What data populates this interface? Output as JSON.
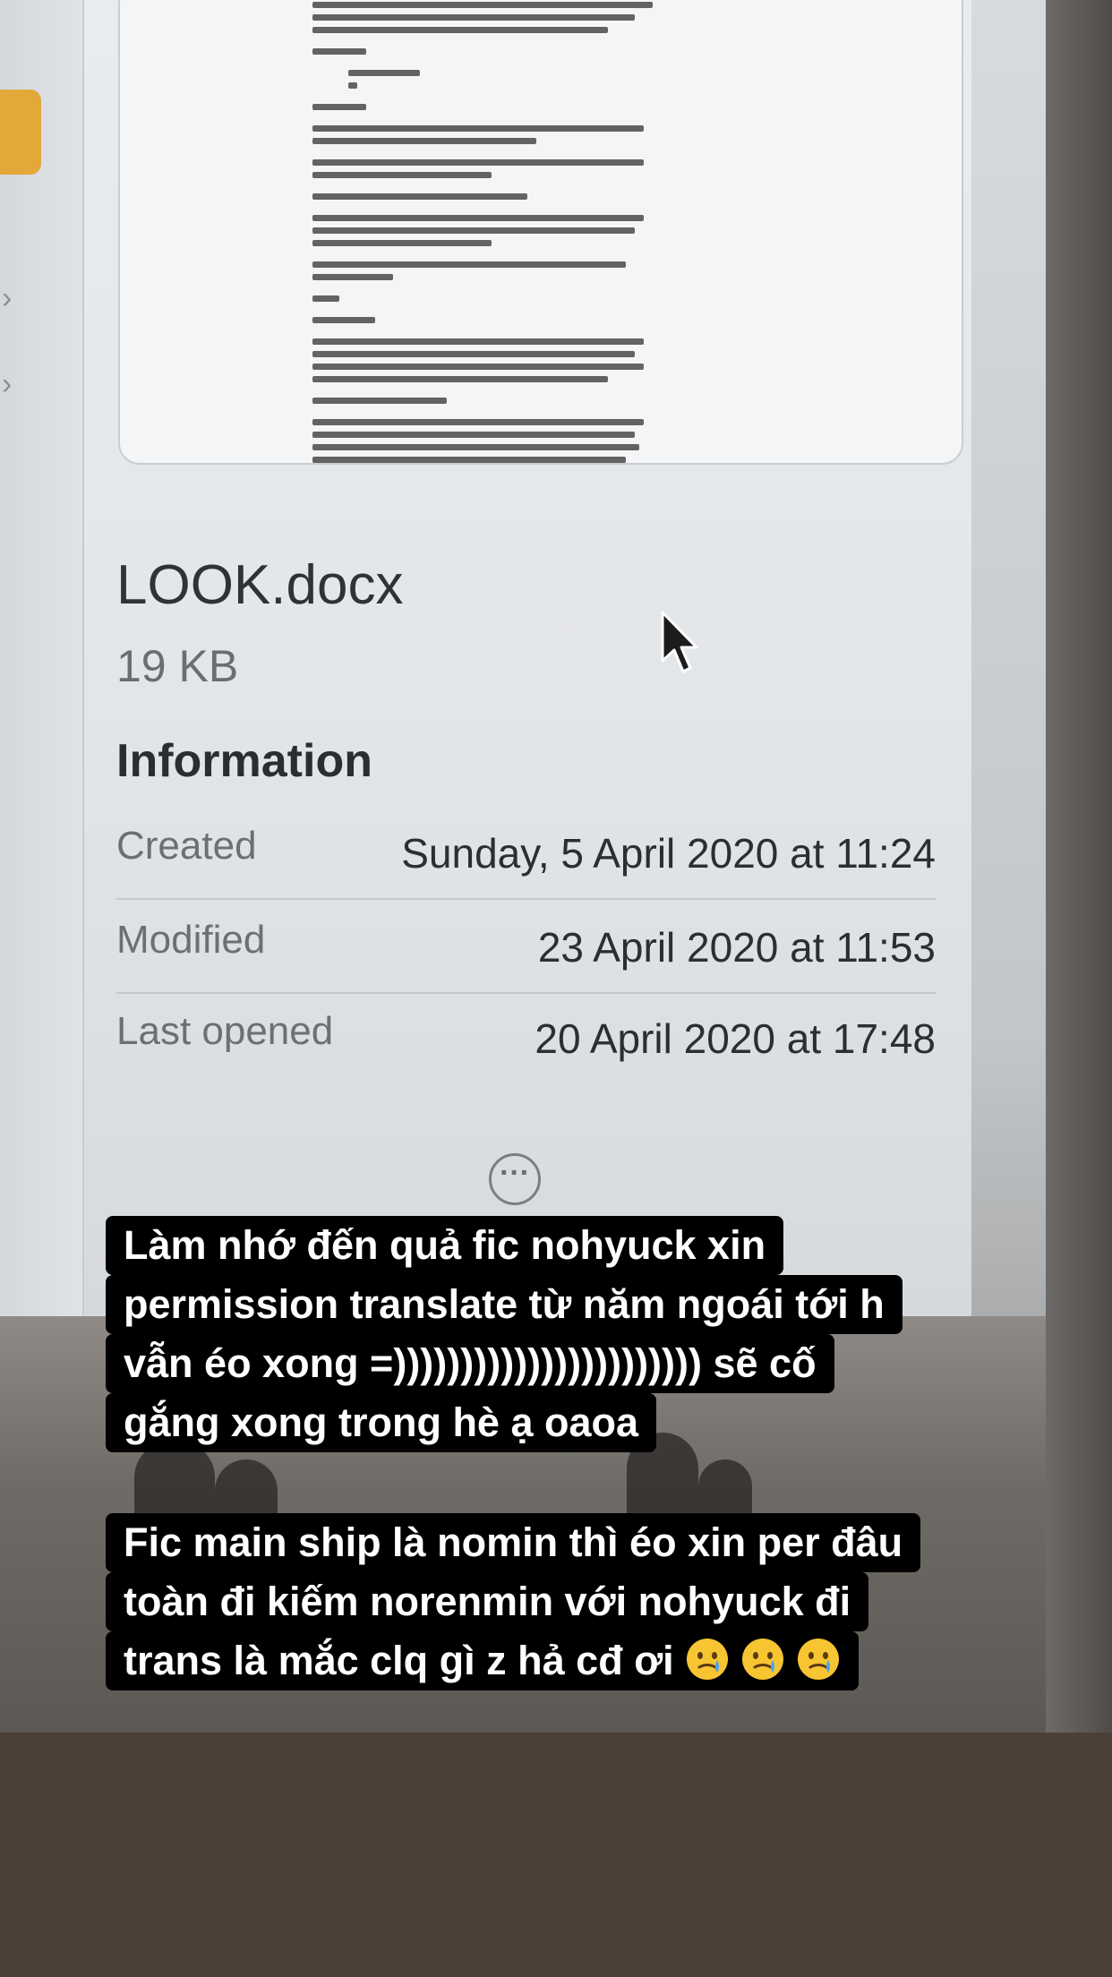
{
  "file_info": {
    "file_name": "LOOK.docx",
    "file_size": "19 KB",
    "section_heading": "Information",
    "rows": [
      {
        "label": "Created",
        "value": "Sunday, 5 April 2020 at 11:24"
      },
      {
        "label": "Modified",
        "value": "23 April 2020 at 11:53"
      },
      {
        "label": "Last opened",
        "value": "20 April 2020 at 17:48"
      }
    ],
    "more_button": "···"
  },
  "sidebar": {
    "chevron_glyph": "›"
  },
  "captions": {
    "block1": [
      "Làm nhớ đến quả fic nohyuck xin",
      "permission translate từ năm ngoái tới h",
      "vẫn éo xong =))))))))))))))))))))))) sẽ cố",
      "gắng xong trong hè ạ oaoa"
    ],
    "block2": [
      "Fic main ship là nomin thì éo xin per đâu",
      "toàn đi kiếm norenmin với nohyuck đi",
      "trans là mắc clq gì z hả cđ ơi"
    ],
    "emoji_count": 3,
    "emoji_icon": "crying-smile-emoji-icon"
  },
  "colors": {
    "caption_background": "#000000",
    "caption_text": "#ffffff",
    "sidebar_tab": "#e2a93a",
    "bottom_band": "#4a4037"
  }
}
